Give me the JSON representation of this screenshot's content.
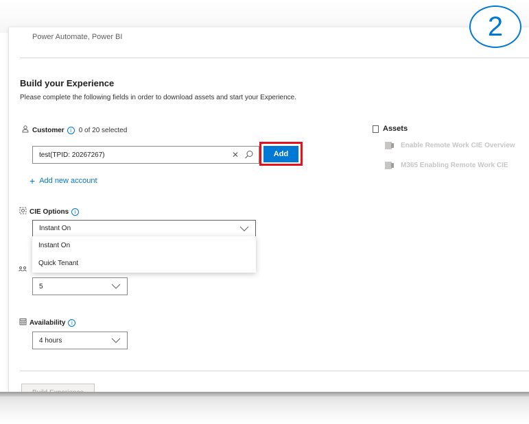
{
  "header_partial_text": "Power Automate, Power BI",
  "build": {
    "title": "Build your Experience",
    "description": "Please complete the following fields in order to download assets and start your Experience."
  },
  "customer": {
    "label": "Customer",
    "selected_count": "0 of 20 selected",
    "input_value": "test(TPID: 20267267)",
    "add_button": "Add",
    "add_account_link": "Add new account"
  },
  "cie_options": {
    "label": "CIE Options",
    "selected": "Instant On",
    "options": [
      "Instant On",
      "Quick Tenant"
    ]
  },
  "hidden_field": {
    "selected": "5"
  },
  "availability": {
    "label": "Availability",
    "selected": "4 hours"
  },
  "assets": {
    "label": "Assets",
    "items": [
      "Enable Remote Work CIE Overview",
      "M365 Enabling Remote Work CIE"
    ]
  },
  "build_button": "Build Experience",
  "step_badge": "2",
  "colors": {
    "accent": "#0078d4",
    "highlight": "#e3131d",
    "disabled_text": "#c8c6c4"
  },
  "icons": {
    "customer": "person-icon",
    "info": "info-icon",
    "cie": "options-icon",
    "availability": "calendar-icon",
    "assets": "document-icon",
    "clear": "close-icon",
    "search": "search-icon",
    "chevron": "chevron-down-icon",
    "add": "plus-icon"
  }
}
